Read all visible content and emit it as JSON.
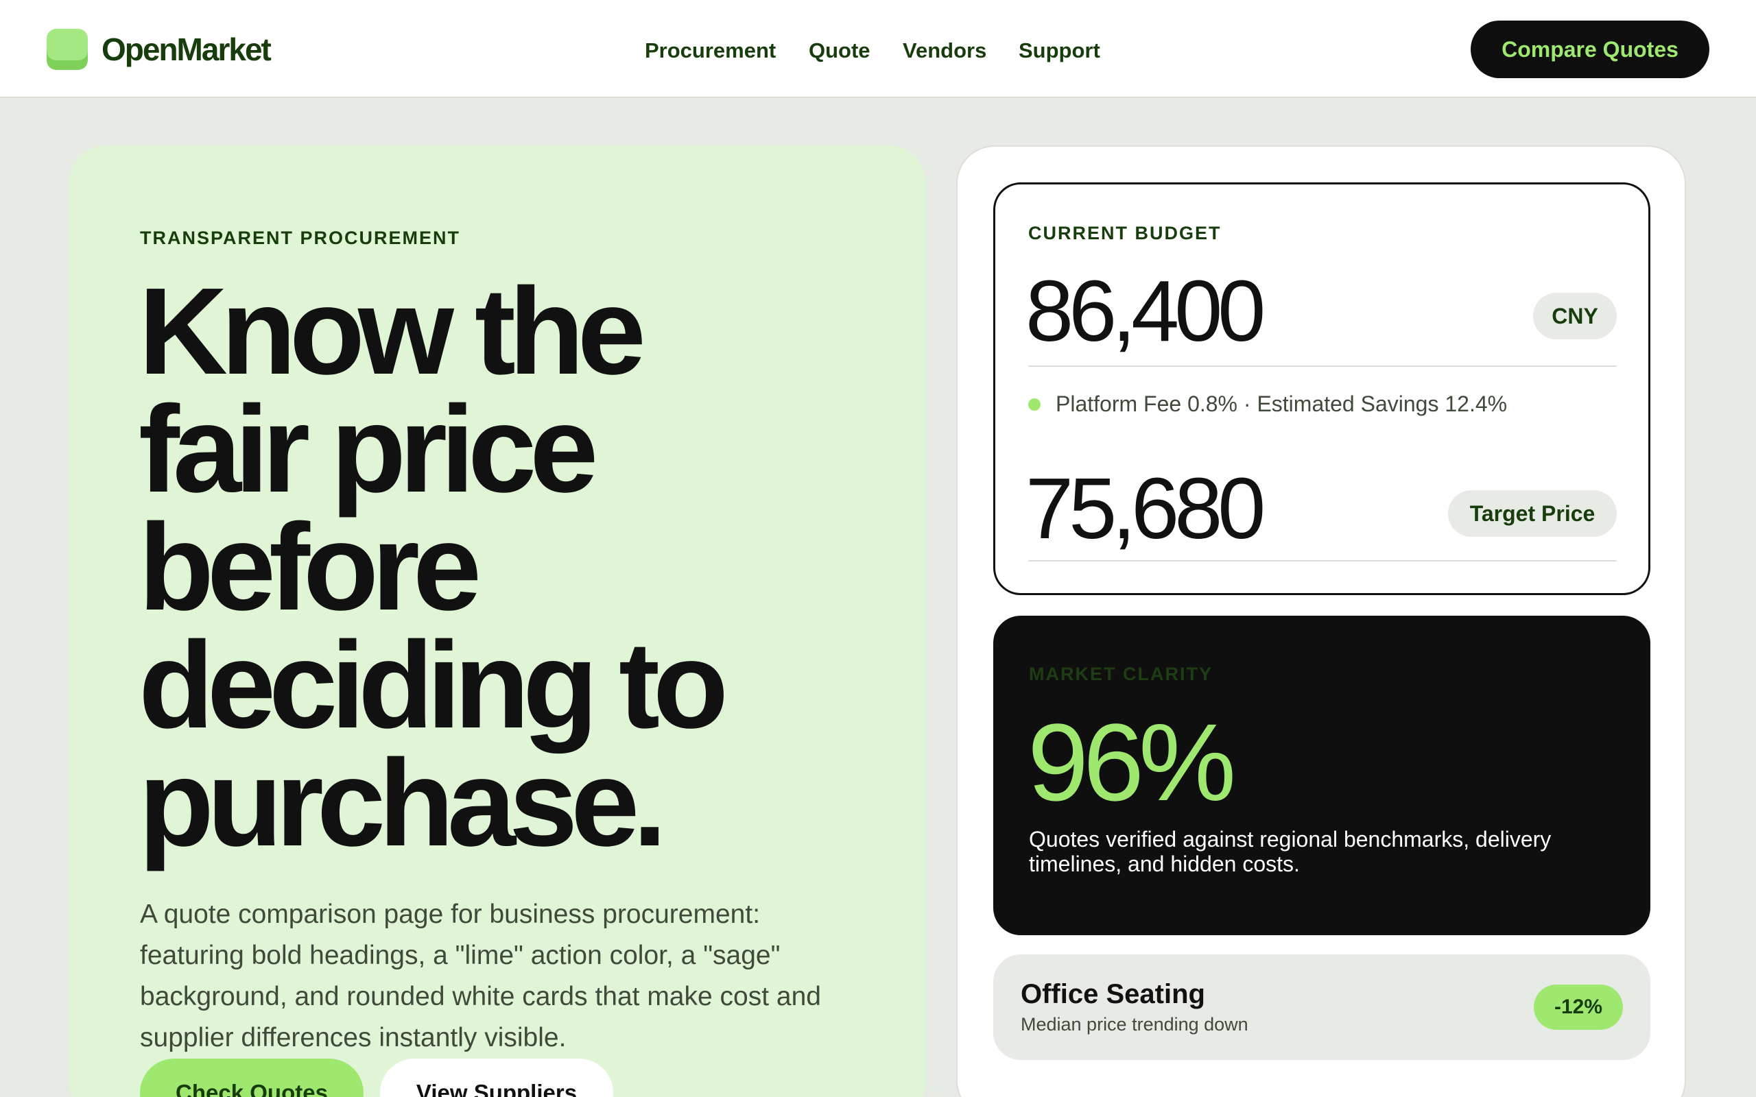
{
  "brand": {
    "name": "OpenMarket"
  },
  "nav": {
    "items": [
      "Procurement",
      "Quote",
      "Vendors",
      "Support"
    ],
    "cta_label": "Compare Quotes"
  },
  "hero": {
    "eyebrow": "TRANSPARENT PROCUREMENT",
    "headline_lines": [
      "Know the",
      "fair price",
      "before",
      "deciding to",
      "purchase."
    ],
    "description": "A quote comparison page for business procurement: featuring bold headings, a \"lime\" action color, a \"sage\" background, and rounded white cards that make cost and supplier differences instantly visible.",
    "primary_button": "Check Quotes",
    "secondary_button": "View Suppliers"
  },
  "budget": {
    "label": "CURRENT BUDGET",
    "amount": "86,400",
    "currency": "CNY",
    "fee_line": "Platform Fee 0.8% · Estimated Savings 12.4%",
    "target_amount": "75,680",
    "target_label": "Target Price"
  },
  "clarity": {
    "label": "MARKET CLARITY",
    "value": "96%",
    "description": "Quotes verified against regional benchmarks, delivery timelines, and hidden costs."
  },
  "item": {
    "title": "Office Seating",
    "subtitle": "Median price trending down",
    "badge": "-12%"
  },
  "colors": {
    "lime": "#9fe870",
    "sage": "#e8eae5",
    "hero_bg": "#e0f5d6",
    "dark": "#0f0f0f",
    "brand_green": "#173d0c"
  }
}
